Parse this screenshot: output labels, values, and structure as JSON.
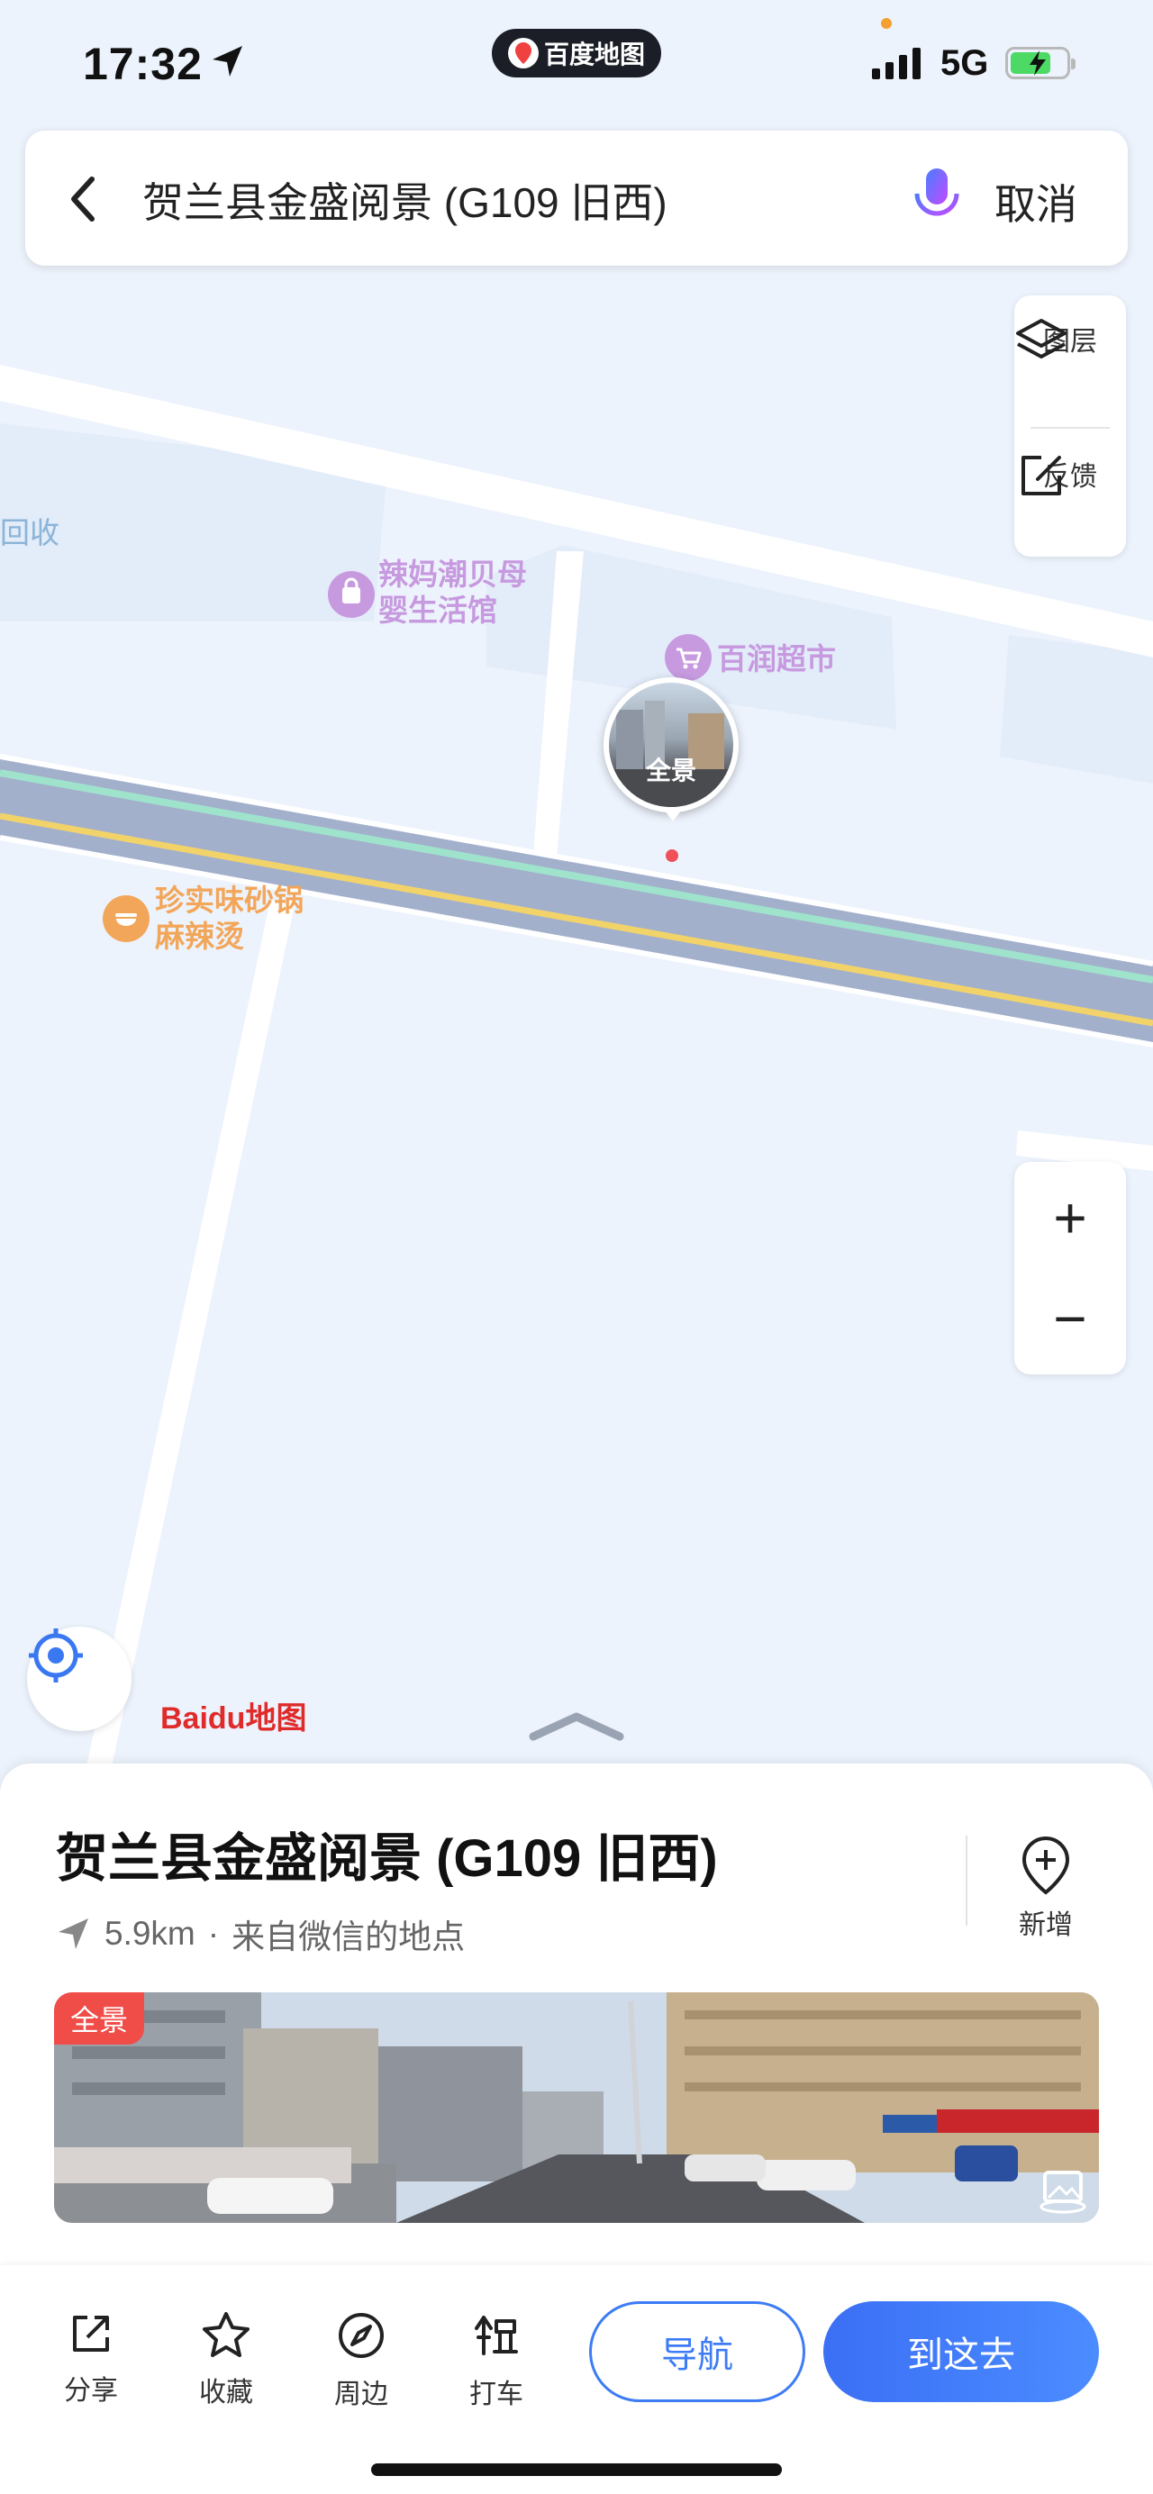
{
  "status_bar": {
    "time": "17:32",
    "network": "5G",
    "app_badge": "百度地图",
    "colors": {
      "battery": "#4cd964",
      "dot": "#f4a030"
    }
  },
  "search": {
    "query": "贺兰县金盛阅景 (G109 旧西)",
    "cancel_label": "取消",
    "icons": [
      "back-chevron-icon",
      "microphone-icon"
    ]
  },
  "map_controls": {
    "layers_label": "图层",
    "feedback_label": "反馈",
    "zoom_in": "+",
    "zoom_out": "−"
  },
  "map": {
    "pois": [
      {
        "label_line1": "辣妈潮贝母",
        "label_line2": "婴生活馆",
        "color": "#c79ae0"
      },
      {
        "label": "百润超市",
        "color": "#c79ae0"
      },
      {
        "label_line1": "珍实味砂锅",
        "label_line2": "麻辣烫",
        "color": "#f2a65a"
      },
      {
        "label": "回收",
        "color": "#8ab4d8"
      }
    ],
    "pano_label": "全景",
    "logo_text": "Baidu地图",
    "colors": {
      "road_main": "#a3b0cc",
      "road_green": "#9fe3cc",
      "road_yellow": "#f2d36a",
      "block": "#e1ebf9"
    }
  },
  "place": {
    "title": "贺兰县金盛阅景 (G109 旧西)",
    "distance": "5.9km",
    "separator": "·",
    "source": "来自微信的地点",
    "add_label": "新增",
    "pano_tag": "全景"
  },
  "actions": {
    "share": "分享",
    "favorite": "收藏",
    "nearby": "周边",
    "taxi": "打车",
    "navigate": "导航",
    "go_here": "到这去",
    "accent": "#3d7cf5"
  }
}
